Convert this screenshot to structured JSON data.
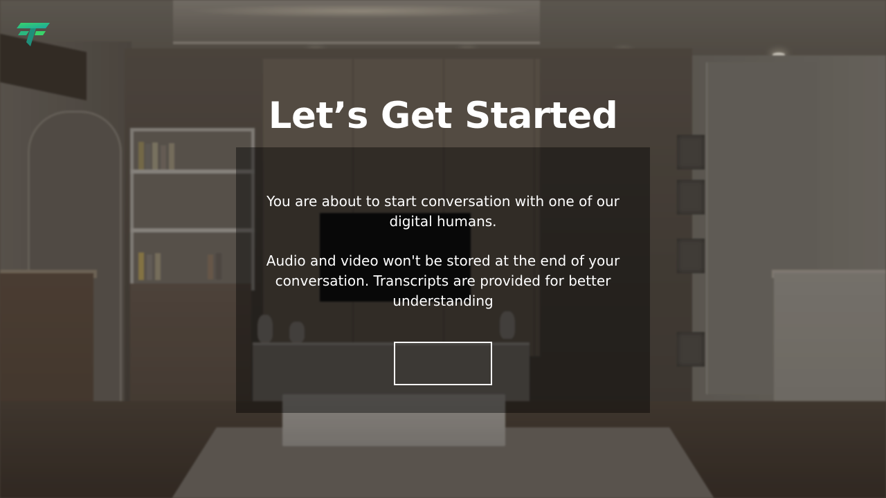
{
  "brand": {
    "logo_icon": "brand-logo-icon",
    "colors": {
      "green": "#3ad36a",
      "teal": "#1aa6a0"
    }
  },
  "page": {
    "title": "Let’s Get Started"
  },
  "intro": {
    "message_1": "You are about to start conversation with one of our digital humans.",
    "message_2": "Audio and video won't be stored at the end of your conversation. Transcripts are provided for better understanding"
  },
  "actions": {
    "start_button_label": ""
  },
  "theme": {
    "panel_background": "rgba(0,0,0,0.42)",
    "text_color": "#ffffff"
  }
}
